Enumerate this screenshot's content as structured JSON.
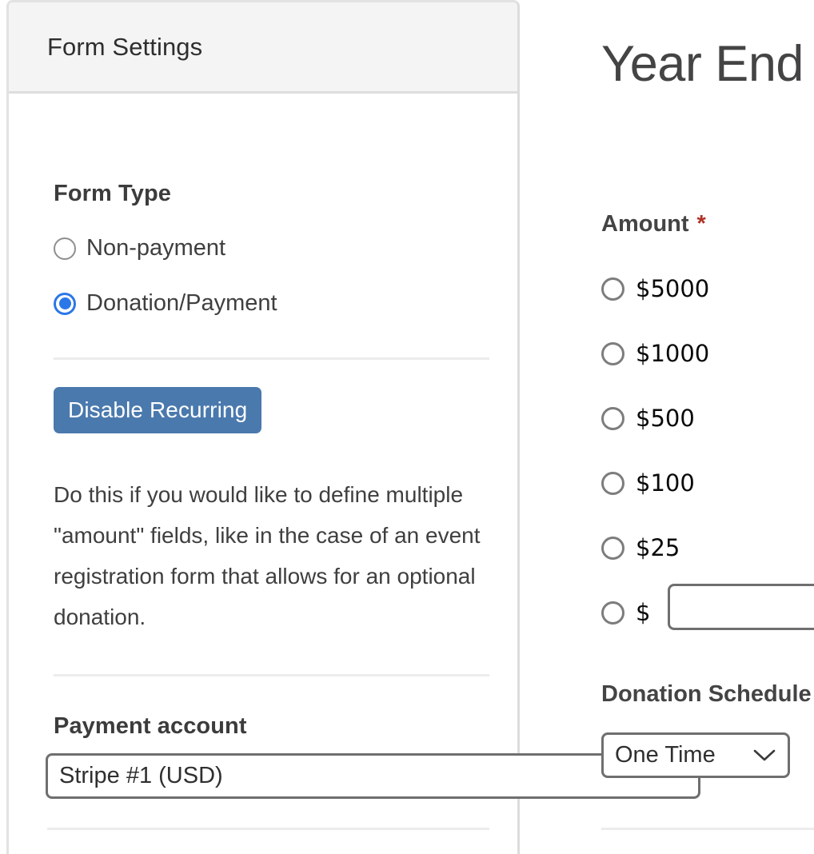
{
  "settings_panel": {
    "header_title": "Form Settings",
    "form_type": {
      "label": "Form Type",
      "options": [
        {
          "label": "Non-payment",
          "selected": false
        },
        {
          "label": "Donation/Payment",
          "selected": true
        }
      ]
    },
    "disable_recurring": {
      "button_label": "Disable Recurring",
      "button_color": "#4a79ad",
      "help_text": "Do this if you would like to define multiple \"amount\" fields, like in the case of an event registration form that allows for an optional donation."
    },
    "payment_account": {
      "label": "Payment account",
      "selected_value": "Stripe #1 (USD)",
      "options": [
        "Stripe #1 (USD)"
      ]
    }
  },
  "form_preview": {
    "title": "Year End",
    "amount_field": {
      "label": "Amount",
      "required_marker": "*",
      "required_color": "#b03226",
      "options": [
        {
          "label": "$5000",
          "value": 5000,
          "selected": false
        },
        {
          "label": "$1000",
          "value": 1000,
          "selected": false
        },
        {
          "label": "$500",
          "value": 500,
          "selected": false
        },
        {
          "label": "$100",
          "value": 100,
          "selected": false
        },
        {
          "label": "$25",
          "value": 25,
          "selected": false
        }
      ],
      "custom": {
        "currency_symbol": "$",
        "value": "",
        "placeholder": "",
        "selected": false
      }
    },
    "donation_schedule": {
      "label": "Donation Schedule",
      "selected_value": "One Time",
      "options": [
        "One Time"
      ],
      "icon": "chevron-down-icon"
    }
  }
}
